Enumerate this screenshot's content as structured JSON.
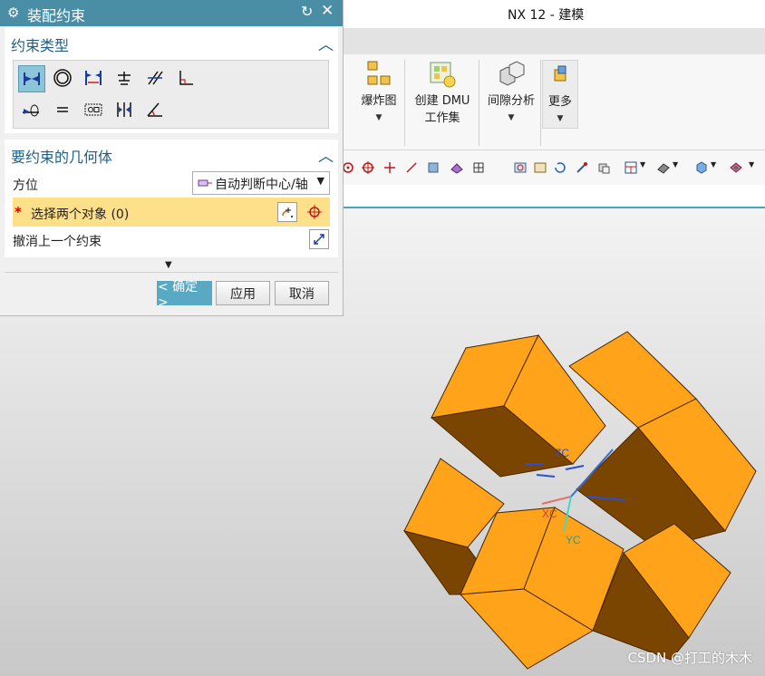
{
  "app": {
    "title": "NX 12 - 建模"
  },
  "ribbon": {
    "buttons": [
      {
        "icon": "exploded-view-icon",
        "label": "爆炸图"
      },
      {
        "icon": "dmu-workset-icon",
        "label": "创建 DMU",
        "label2": "工作集"
      },
      {
        "icon": "clearance-analysis-icon",
        "label": "间隙分析"
      },
      {
        "icon": "more-icon",
        "label": "更多"
      }
    ]
  },
  "dialog": {
    "title": "装配约束",
    "constraint_type": {
      "header": "约束类型",
      "icons": [
        "touch-align-icon",
        "concentric-icon",
        "distance-icon",
        "fix-icon",
        "parallel-icon",
        "perpendicular-icon",
        "align-lock-icon",
        "equal-icon",
        "fit-icon",
        "center-icon",
        "angle-icon"
      ]
    },
    "geometry": {
      "header": "要约束的几何体",
      "orientation_label": "方位",
      "orientation_value": "自动判断中心/轴",
      "select_label": "选择两个对象 (0)",
      "undo_label": "撤消上一个约束"
    },
    "buttons": {
      "ok": "< 确定 >",
      "apply": "应用",
      "cancel": "取消"
    }
  },
  "viewport": {
    "axes": {
      "x": "XC",
      "y": "YC",
      "z": "ZC"
    },
    "watermark": "CSDN @打工的木木"
  },
  "colors": {
    "accent": "#4a8ea6",
    "part_light": "#ffa31a",
    "part_dark": "#7a4500",
    "highlight": "#ffe08a"
  }
}
